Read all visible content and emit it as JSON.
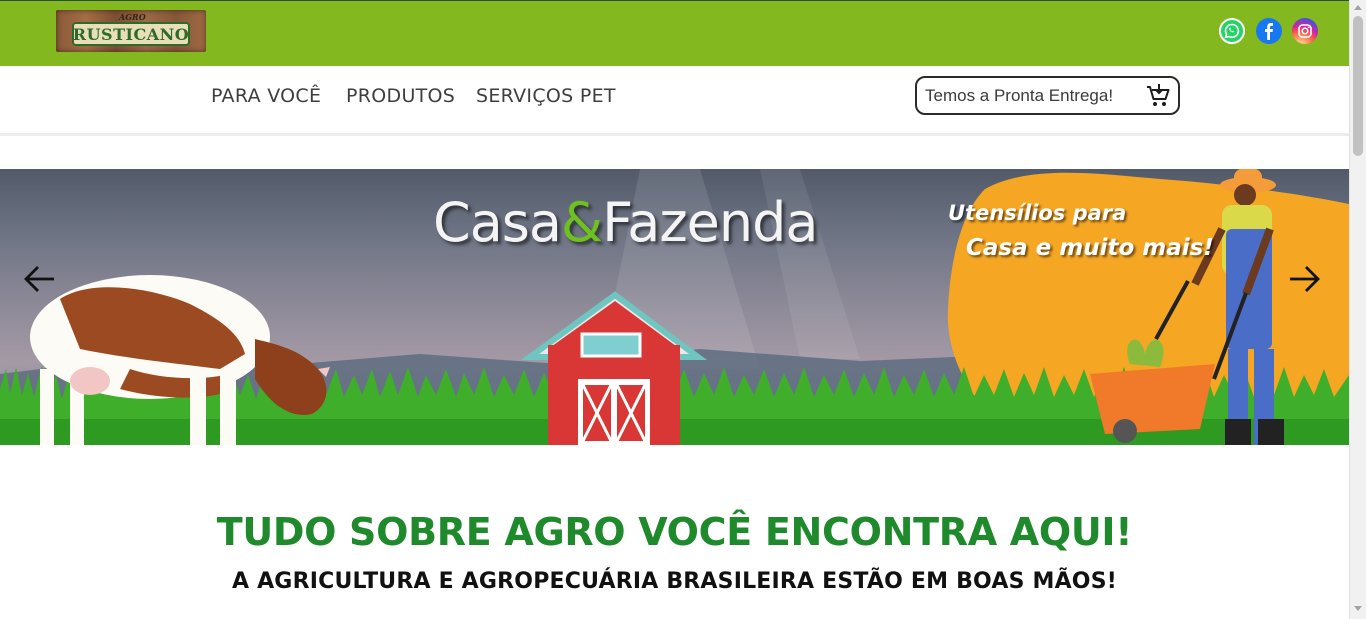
{
  "brand": {
    "logo_top": "AGRO",
    "logo_name": "RUSTICANO"
  },
  "social": {
    "whatsapp_icon": "whatsapp-icon",
    "facebook_icon": "facebook-icon",
    "instagram_icon": "instagram-icon"
  },
  "nav": {
    "items": [
      {
        "label": "PARA VOCÊ"
      },
      {
        "label": "PRODUTOS"
      },
      {
        "label": "SERVIÇOS PET"
      }
    ]
  },
  "search": {
    "placeholder": "Temos a Pronta Entrega!",
    "cart_icon": "cart-icon"
  },
  "banner": {
    "title_part1": "Casa",
    "title_amp": "&",
    "title_part2": "Fazenda",
    "slogan_line1": "Utensílios para",
    "slogan_line2": "Casa e muito mais!",
    "prev_icon": "arrow-left-icon",
    "next_icon": "arrow-right-icon"
  },
  "main": {
    "headline": "TUDO SOBRE AGRO VOCÊ ENCONTRA AQUI!",
    "subline": "A AGRICULTURA E AGROPECUÁRIA BRASILEIRA ESTÃO EM BOAS MÃOS!"
  },
  "colors": {
    "topbar": "#83b81f",
    "headline": "#1f8a2c",
    "accent_orange": "#f5a623"
  }
}
